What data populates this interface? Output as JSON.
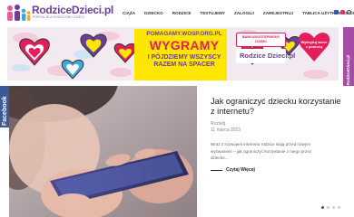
{
  "header": {
    "logo_text": "RodziceDzieci.pl",
    "logo_tagline": "PORTAL DLA RODZICÓW I DZIECI",
    "nav": [
      "CIĄŻA",
      "DZIECKO",
      "RODZICE",
      "TESTUJEMY",
      "ZALOGUJ",
      "ZAREJESTRUJ",
      "TABLICA UŻYTKOWNIKÓW"
    ],
    "social_icons": [
      "facebook-icon",
      "instagram-icon",
      "search-icon"
    ]
  },
  "banner": {
    "url_text": "POMAGAMY.WOSP.ORG.PL",
    "headline": "WYGRAMY",
    "subline_1": "I PÓJDZIEMY WSZYSCY",
    "subline_2": "RAZEM NA SPACER",
    "badge_text": "BAWI UDOSTĘPNIONY DZIĘKI",
    "logo_text": "Rodzice Dzieci.pl",
    "heart_text": "Wylicytuj serce z pomocą",
    "side_tab": "RodziceDzieci.pl"
  },
  "facebook_tab": "Facebook",
  "article": {
    "title": "Jak ograniczyć dziecku korzystanie z internetu?",
    "category": "Rozwój",
    "date": "11 marca 2023",
    "excerpt": "Wraz z rozwojem internetu rodzice stają przed nowym wyzwaniem – jak ograniczyć korzystanie z niego przez dziecko...",
    "read_more": "Czytaj Więcej"
  },
  "slider": {
    "dots": 4,
    "active": 0
  },
  "colors": {
    "brand": "#6a3e98",
    "accent": "#e31e5a",
    "banner_yellow": "#ffe600",
    "facebook": "#3b5998"
  }
}
